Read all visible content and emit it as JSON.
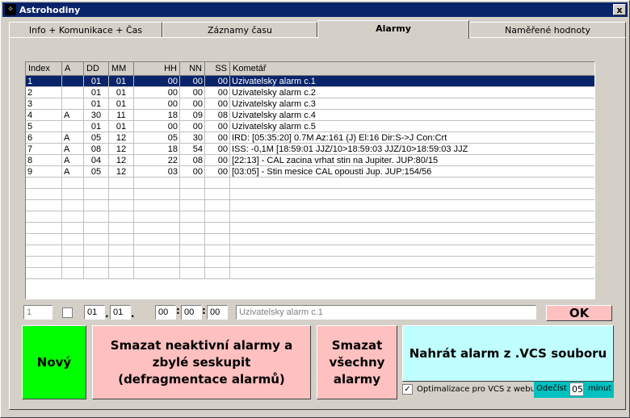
{
  "window": {
    "title": "Astrohodiny",
    "close_label": "x"
  },
  "tabs": [
    {
      "label": "Info + Komunikace + Čas"
    },
    {
      "label": "Záznamy času"
    },
    {
      "label": "Alarmy"
    },
    {
      "label": "Naměřené hodnoty"
    }
  ],
  "table": {
    "headers": [
      "Index",
      "A",
      "DD",
      "MM",
      "HH",
      "NN",
      "SS",
      "Kometář"
    ],
    "rows": [
      [
        "1",
        "",
        "01",
        "01",
        "00",
        "00",
        "00",
        "Uzivatelsky    alarm c.1"
      ],
      [
        "2",
        "",
        "01",
        "01",
        "00",
        "00",
        "00",
        "Uzivatelsky    alarm c.2"
      ],
      [
        "3",
        "",
        "01",
        "01",
        "00",
        "00",
        "00",
        "Uzivatelsky    alarm c.3"
      ],
      [
        "4",
        "A",
        "30",
        "11",
        "18",
        "09",
        "08",
        "Uzivatelsky    alarm c.4"
      ],
      [
        "5",
        "",
        "01",
        "01",
        "00",
        "00",
        "00",
        "Uzivatelsky    alarm c.5"
      ],
      [
        "6",
        "A",
        "05",
        "12",
        "05",
        "30",
        "00",
        "IRD: [05:35:20] 0.7M Az:161 (J) El:16 Dir:S->J Con:Crt"
      ],
      [
        "7",
        "A",
        "08",
        "12",
        "18",
        "54",
        "00",
        "ISS: -0,1M [18:59:01 JJZ/10>18:59:03 JJZ/10>18:59:03 JJZ"
      ],
      [
        "8",
        "A",
        "04",
        "12",
        "22",
        "08",
        "00",
        "[22:13] - CAL  zacina vrhat stin na Jupiter. JUP:80/15"
      ],
      [
        "9",
        "A",
        "05",
        "12",
        "03",
        "00",
        "00",
        "[03:05] - Stin mesice CAL  opousti Jup. JUP:154/56"
      ]
    ],
    "selected_index": 0
  },
  "edit": {
    "index": "1",
    "dd": "01",
    "mm": "01",
    "hh": "00",
    "nn": "00",
    "ss": "00",
    "comment": "Uzivatelsky    alarm c.1",
    "ok_label": "OK",
    "sep_dot": ".",
    "sep_colon": ":"
  },
  "buttons": {
    "new_label": "Nový",
    "defrag_label": "Smazat neaktivní alarmy a zbylé seskupit (defragmentace alarmů)",
    "delete_all_label": "Smazat všechny alarmy",
    "load_vcs_label": "Nahrát alarm z .VCS souboru"
  },
  "options": {
    "optimize_label": "Optimalizace pro VCS z webu",
    "optimize_checked": "✓",
    "subtract_label": "Odečíst",
    "subtract_value": "05",
    "minutes_label": "minut"
  },
  "colors": {
    "new_button": "#00ff00",
    "pink_button": "#ffc0c0",
    "cyan_button": "#c0ffff",
    "cyan_bar": "#00c0c0",
    "selection": "#0a246a"
  }
}
